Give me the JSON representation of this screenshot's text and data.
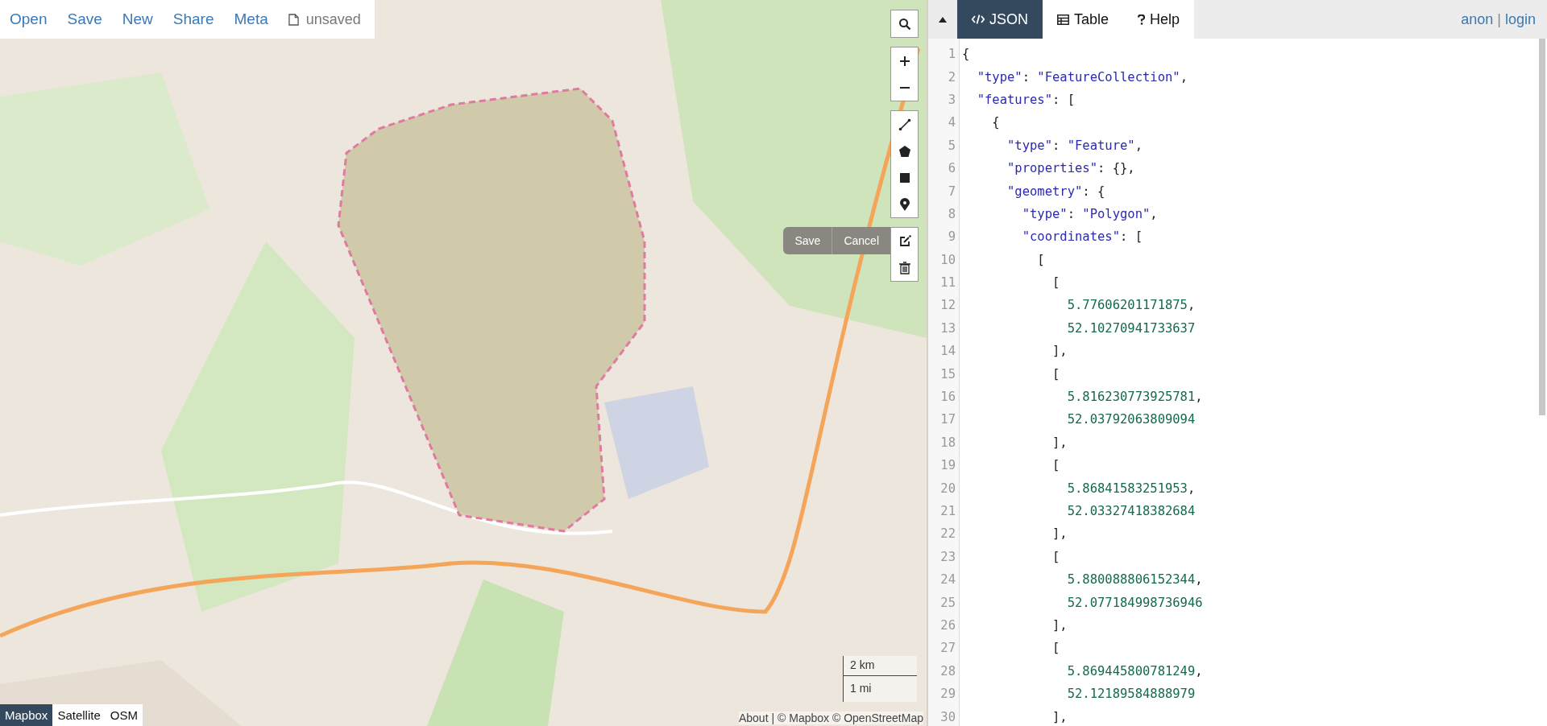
{
  "menu": [
    {
      "label": "Open"
    },
    {
      "label": "Save"
    },
    {
      "label": "New"
    },
    {
      "label": "Share"
    },
    {
      "label": "Meta"
    }
  ],
  "file_status": "unsaved",
  "map": {
    "kind": "picture"
  },
  "edit_actions": [
    "Save",
    "Cancel"
  ],
  "scale": [
    "2 km",
    "1 mi"
  ],
  "attribution": {
    "link": "About",
    "text": "| © Mapbox © OpenStreetMap"
  },
  "layers": [
    {
      "label": "Mapbox",
      "selected": true
    },
    {
      "label": "Satellite",
      "selected": false
    },
    {
      "label": "OSM",
      "selected": false
    }
  ],
  "tabs": [
    {
      "label": "JSON",
      "selected": true
    },
    {
      "label": "Table",
      "selected": false
    },
    {
      "label": "Help",
      "selected": false
    }
  ],
  "user": {
    "name": "anon",
    "separator": "|",
    "login": "login"
  },
  "code_lines": [
    {
      "n": "1",
      "tokens": [
        {
          "kind": "punct",
          "text": "{"
        }
      ]
    },
    {
      "n": "2",
      "tokens": [
        {
          "kind": "key",
          "text": "  \"type\""
        },
        {
          "kind": "punct",
          "text": ": "
        },
        {
          "kind": "string",
          "text": "\"FeatureCollection\""
        },
        {
          "kind": "punct",
          "text": ","
        }
      ]
    },
    {
      "n": "3",
      "tokens": [
        {
          "kind": "key",
          "text": "  \"features\""
        },
        {
          "kind": "punct",
          "text": ": ["
        }
      ]
    },
    {
      "n": "4",
      "tokens": [
        {
          "kind": "punct",
          "text": "    {"
        }
      ]
    },
    {
      "n": "5",
      "tokens": [
        {
          "kind": "key",
          "text": "      \"type\""
        },
        {
          "kind": "punct",
          "text": ": "
        },
        {
          "kind": "string",
          "text": "\"Feature\""
        },
        {
          "kind": "punct",
          "text": ","
        }
      ]
    },
    {
      "n": "6",
      "tokens": [
        {
          "kind": "key",
          "text": "      \"properties\""
        },
        {
          "kind": "punct",
          "text": ": {},"
        }
      ]
    },
    {
      "n": "7",
      "tokens": [
        {
          "kind": "key",
          "text": "      \"geometry\""
        },
        {
          "kind": "punct",
          "text": ": {"
        }
      ]
    },
    {
      "n": "8",
      "tokens": [
        {
          "kind": "key",
          "text": "        \"type\""
        },
        {
          "kind": "punct",
          "text": ": "
        },
        {
          "kind": "string",
          "text": "\"Polygon\""
        },
        {
          "kind": "punct",
          "text": ","
        }
      ]
    },
    {
      "n": "9",
      "tokens": [
        {
          "kind": "key",
          "text": "        \"coordinates\""
        },
        {
          "kind": "punct",
          "text": ": ["
        }
      ]
    },
    {
      "n": "10",
      "tokens": [
        {
          "kind": "punct",
          "text": "          ["
        }
      ]
    },
    {
      "n": "11",
      "tokens": [
        {
          "kind": "punct",
          "text": "            ["
        }
      ]
    },
    {
      "n": "12",
      "tokens": [
        {
          "kind": "number",
          "text": "              5.77606201171875"
        },
        {
          "kind": "punct",
          "text": ","
        }
      ]
    },
    {
      "n": "13",
      "tokens": [
        {
          "kind": "number",
          "text": "              52.10270941733637"
        }
      ]
    },
    {
      "n": "14",
      "tokens": [
        {
          "kind": "punct",
          "text": "            ],"
        }
      ]
    },
    {
      "n": "15",
      "tokens": [
        {
          "kind": "punct",
          "text": "            ["
        }
      ]
    },
    {
      "n": "16",
      "tokens": [
        {
          "kind": "number",
          "text": "              5.816230773925781"
        },
        {
          "kind": "punct",
          "text": ","
        }
      ]
    },
    {
      "n": "17",
      "tokens": [
        {
          "kind": "number",
          "text": "              52.03792063809094"
        }
      ]
    },
    {
      "n": "18",
      "tokens": [
        {
          "kind": "punct",
          "text": "            ],"
        }
      ]
    },
    {
      "n": "19",
      "tokens": [
        {
          "kind": "punct",
          "text": "            ["
        }
      ]
    },
    {
      "n": "20",
      "tokens": [
        {
          "kind": "number",
          "text": "              5.86841583251953"
        },
        {
          "kind": "punct",
          "text": ","
        }
      ]
    },
    {
      "n": "21",
      "tokens": [
        {
          "kind": "number",
          "text": "              52.03327418382684"
        }
      ]
    },
    {
      "n": "22",
      "tokens": [
        {
          "kind": "punct",
          "text": "            ],"
        }
      ]
    },
    {
      "n": "23",
      "tokens": [
        {
          "kind": "punct",
          "text": "            ["
        }
      ]
    },
    {
      "n": "24",
      "tokens": [
        {
          "kind": "number",
          "text": "              5.880088806152344"
        },
        {
          "kind": "punct",
          "text": ","
        }
      ]
    },
    {
      "n": "25",
      "tokens": [
        {
          "kind": "number",
          "text": "              52.077184998736946"
        }
      ]
    },
    {
      "n": "26",
      "tokens": [
        {
          "kind": "punct",
          "text": "            ],"
        }
      ]
    },
    {
      "n": "27",
      "tokens": [
        {
          "kind": "punct",
          "text": "            ["
        }
      ]
    },
    {
      "n": "28",
      "tokens": [
        {
          "kind": "number",
          "text": "              5.869445800781249"
        },
        {
          "kind": "punct",
          "text": ","
        }
      ]
    },
    {
      "n": "29",
      "tokens": [
        {
          "kind": "number",
          "text": "              52.12189584888979"
        }
      ]
    },
    {
      "n": "30",
      "tokens": [
        {
          "kind": "punct",
          "text": "            ],"
        }
      ]
    }
  ]
}
